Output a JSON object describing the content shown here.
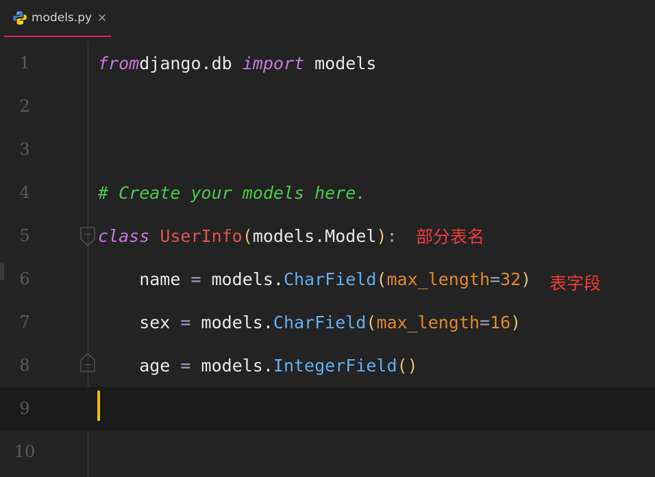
{
  "tab": {
    "filename": "models.py",
    "close_glyph": "×"
  },
  "lines": [
    {
      "num": "1",
      "tokens": [
        [
          "kw",
          "from"
        ],
        [
          "",
          "django.db "
        ],
        [
          "kw",
          "import"
        ],
        [
          "",
          " models"
        ]
      ]
    },
    {
      "num": "2",
      "tokens": []
    },
    {
      "num": "3",
      "tokens": []
    },
    {
      "num": "4",
      "tokens": [
        [
          "cm",
          "# Create your models here."
        ]
      ]
    },
    {
      "num": "5",
      "tokens": [
        [
          "kw",
          "class"
        ],
        [
          "",
          " "
        ],
        [
          "cls",
          "UserInfo"
        ],
        [
          "par",
          "("
        ],
        [
          "",
          "models.Model"
        ],
        [
          "par",
          ")"
        ],
        [
          "op",
          ":"
        ]
      ]
    },
    {
      "num": "6",
      "tokens": [
        [
          "",
          "    name "
        ],
        [
          "op",
          "="
        ],
        [
          "",
          " models."
        ],
        [
          "fn",
          "CharField"
        ],
        [
          "par",
          "("
        ],
        [
          "prm",
          "max_length"
        ],
        [
          "op",
          "="
        ],
        [
          "num",
          "32"
        ],
        [
          "par",
          ")"
        ]
      ]
    },
    {
      "num": "7",
      "tokens": [
        [
          "",
          "    sex "
        ],
        [
          "op",
          "="
        ],
        [
          "",
          " models."
        ],
        [
          "fn",
          "CharField"
        ],
        [
          "par",
          "("
        ],
        [
          "prm",
          "max_length"
        ],
        [
          "op",
          "="
        ],
        [
          "num",
          "16"
        ],
        [
          "par",
          ")"
        ]
      ]
    },
    {
      "num": "8",
      "tokens": [
        [
          "",
          "    age "
        ],
        [
          "op",
          "="
        ],
        [
          "",
          " models."
        ],
        [
          "fn",
          "IntegerField"
        ],
        [
          "par",
          "()"
        ]
      ]
    },
    {
      "num": "9",
      "tokens": []
    },
    {
      "num": "10",
      "tokens": []
    }
  ],
  "annotations": {
    "table_name": "部分表名",
    "table_fields": "表字段"
  },
  "colors": {
    "keyword": "#c678dd",
    "comment": "#4ec94e",
    "class_name": "#e05252",
    "function": "#61afef",
    "param": "#e08a2c",
    "annotation": "#f03a3a",
    "cursor": "#f0c000",
    "tab_underline": "#e0245e"
  },
  "icons": {
    "tab_icon": "python-icon",
    "fold_open": "fold-open-icon",
    "fold_close": "fold-close-icon"
  }
}
